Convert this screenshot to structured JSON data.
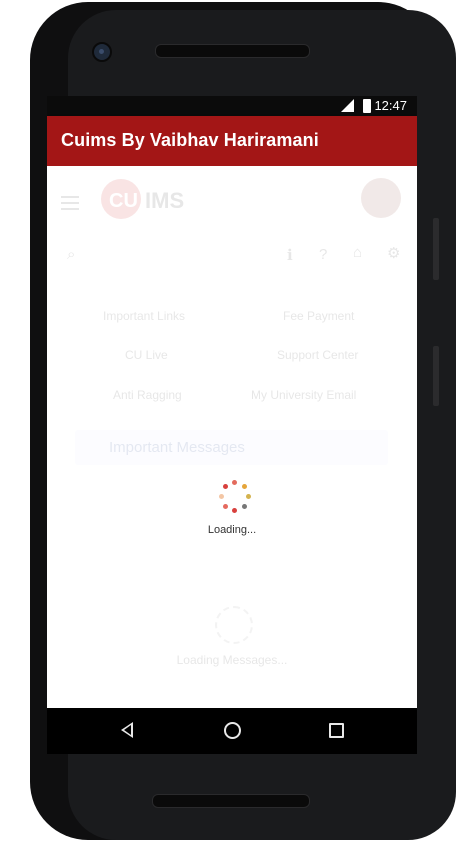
{
  "status_bar": {
    "network": "LTE",
    "time": "12:47"
  },
  "app_bar": {
    "title": "Cuims By Vaibhav Hariramani"
  },
  "webview": {
    "header": {
      "logo_text": "CU IMS"
    },
    "links": [
      {
        "label": "Important Links",
        "icon": "link-icon"
      },
      {
        "label": "Fee Payment",
        "icon": "card-icon"
      },
      {
        "label": "CU Live",
        "icon": "tv-icon"
      },
      {
        "label": "Support Center",
        "icon": "search-icon"
      },
      {
        "label": "Anti Ragging",
        "icon": "flag-icon"
      },
      {
        "label": "My University Email",
        "icon": "mail-icon"
      }
    ],
    "banner": {
      "label": "Important Messages"
    },
    "messages_loading": "Loading Messages..."
  },
  "overlay": {
    "loading_label": "Loading..."
  },
  "colors": {
    "app_bar": "#a31616",
    "banner": "#dfe6ff"
  }
}
